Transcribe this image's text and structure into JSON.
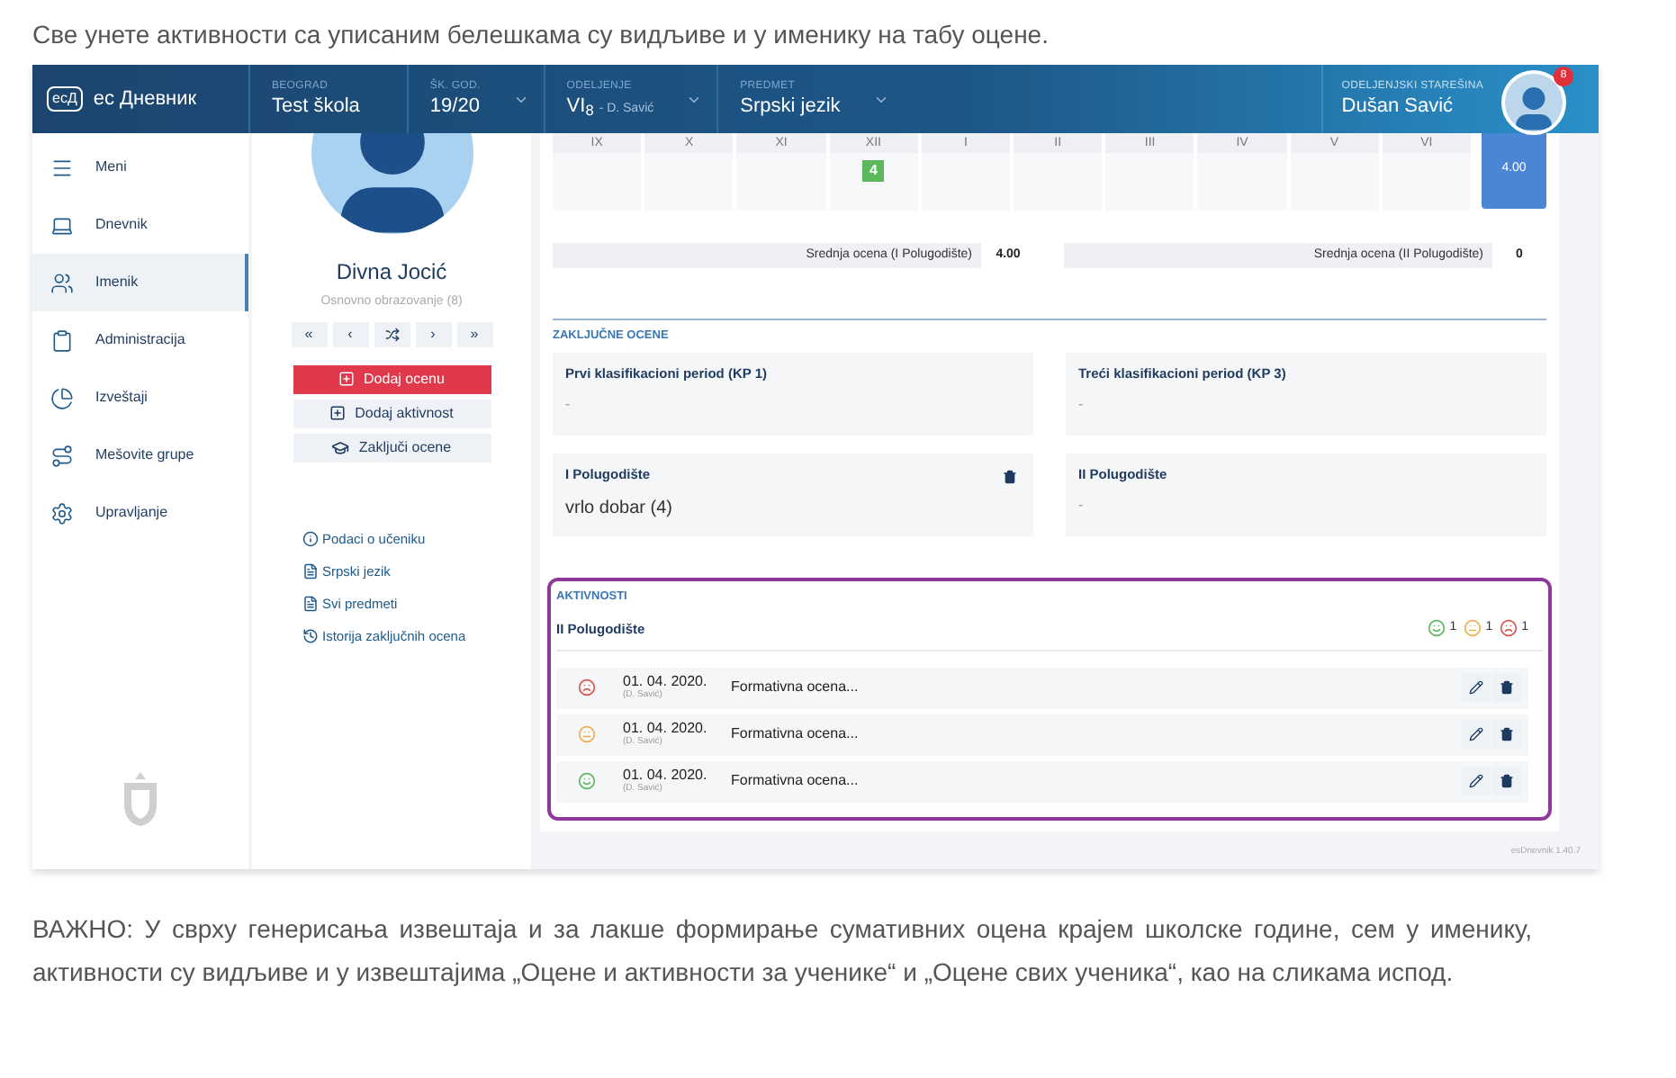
{
  "article": {
    "intro": "Све унете активности са уписаним белешкама су видљиве и у именику на табу оцене.",
    "paragraph": "ВАЖНО: У сврху генерисања извештаја и за лакше формирање сумативних оцена крајем школске године, сем у именику, активности су видљиве и у извештајима „Оцене и активности за ученике“ и „Оцене свих ученика“, као на сликама испод."
  },
  "header": {
    "logo_mark": "ecД",
    "app_name": "ес Дневник",
    "selectors": [
      {
        "label": "BEOGRAD",
        "value": "Test škola",
        "dropdown": false
      },
      {
        "label": "ŠK. GOD.",
        "value": "19/20",
        "dropdown": true
      },
      {
        "label": "ODELJENJE",
        "value": "VI$_{8}$",
        "note": "- D. Savić",
        "dropdown": true
      },
      {
        "label": "PREDMET",
        "value": "Srpski jezik",
        "dropdown": true
      }
    ],
    "user": {
      "label": "ODELJENJSKI STAREŠINA",
      "name": "Dušan Savić",
      "badge": "8"
    }
  },
  "sidebar": {
    "items": [
      {
        "label": "Meni",
        "selected": false
      },
      {
        "label": "Dnevnik",
        "selected": false
      },
      {
        "label": "Imenik",
        "selected": true
      },
      {
        "label": "Administracija",
        "selected": false
      },
      {
        "label": "Izveštaji",
        "selected": false
      },
      {
        "label": "Mešovite grupe",
        "selected": false
      },
      {
        "label": "Upravljanje",
        "selected": false
      }
    ]
  },
  "student": {
    "name": "Divna Jocić",
    "program": "Osnovno obrazovanje (8)",
    "nav": [
      "«",
      "‹",
      "›",
      "»"
    ],
    "actions": [
      {
        "label": "Dodaj ocenu",
        "kind": "primary"
      },
      {
        "label": "Dodaj aktivnost",
        "kind": "secondary"
      },
      {
        "label": "Zaključi ocene",
        "kind": "close"
      }
    ],
    "links": [
      {
        "label": "Podaci o učeniku",
        "kind": "info"
      },
      {
        "label": "Srpski jezik",
        "kind": "document"
      },
      {
        "label": "Svi predmeti",
        "kind": "document"
      },
      {
        "label": "Istorija zaključnih ocena",
        "kind": "history"
      }
    ]
  },
  "grades": {
    "months": [
      {
        "month": "IX"
      },
      {
        "month": "X"
      },
      {
        "month": "XI"
      },
      {
        "month": "XII",
        "grade": "4"
      },
      {
        "month": "I"
      },
      {
        "month": "II"
      },
      {
        "month": "III"
      },
      {
        "month": "IV"
      },
      {
        "month": "V"
      },
      {
        "month": "VI"
      }
    ],
    "average": "4.00",
    "semester_averages": [
      {
        "label": "Srednja ocena (I Polugodište)",
        "value": "4.00"
      },
      {
        "label": "Srednja ocena (II Polugodište)",
        "value": "0"
      }
    ]
  },
  "final_grades": {
    "title": "ZAKLJUČNE OCENE",
    "cards": [
      {
        "title": "Prvi klasifikacioni period (KP 1)",
        "value": "-",
        "deletable": false
      },
      {
        "title": "Treći klasifikacioni period (KP 3)",
        "value": "-",
        "deletable": false
      },
      {
        "title": "I Polugodište",
        "value": "vrlo dobar (4)",
        "deletable": true
      },
      {
        "title": "II Polugodište",
        "value": "-",
        "deletable": false
      }
    ]
  },
  "activities": {
    "title": "AKTIVNOSTI",
    "period": "II Polugodište",
    "summary": [
      {
        "kind": "happy",
        "count": "1"
      },
      {
        "kind": "neutral",
        "count": "1"
      },
      {
        "kind": "sad",
        "count": "1"
      }
    ],
    "rows": [
      {
        "kind": "sad",
        "date": "01. 04. 2020.",
        "author": "(D. Savić)",
        "text": "Formativna ocena..."
      },
      {
        "kind": "neutral",
        "date": "01. 04. 2020.",
        "author": "(D. Savić)",
        "text": "Formativna ocena..."
      },
      {
        "kind": "happy",
        "date": "01. 04. 2020.",
        "author": "(D. Savić)",
        "text": "Formativna ocena..."
      }
    ]
  },
  "version": "esDnevnik 1.40.7"
}
